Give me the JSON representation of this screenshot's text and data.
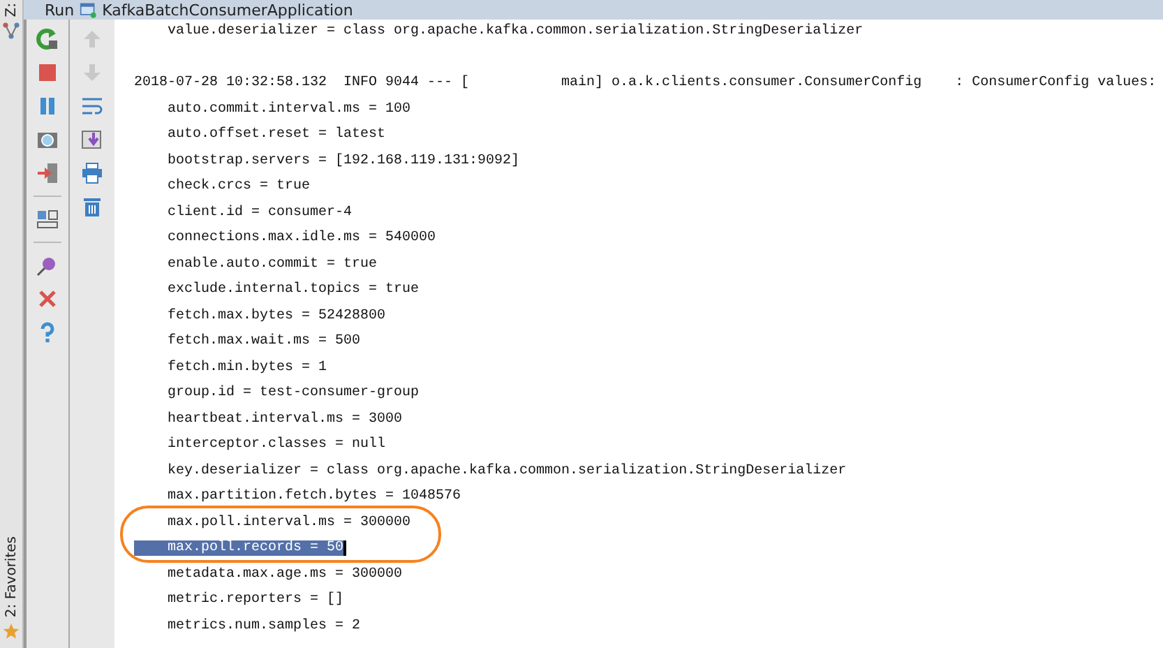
{
  "left_strip": {
    "top_tab": "Z:",
    "bottom_tab": "2: Favorites"
  },
  "run_bar": {
    "label": "Run",
    "config": "KafkaBatchConsumerApplication"
  },
  "console": {
    "lines": [
      {
        "text": "    value.deserializer = class org.apache.kafka.common.serialization.StringDeserializer",
        "selected": false
      },
      {
        "selected": false
      },
      {
        "text": "2018-07-28 10:32:58.132  INFO 9044 --- [           main] o.a.k.clients.consumer.ConsumerConfig    : ConsumerConfig values:",
        "selected": false
      },
      {
        "text": "    auto.commit.interval.ms = 100",
        "selected": false
      },
      {
        "text": "    auto.offset.reset = latest",
        "selected": false
      },
      {
        "text": "    bootstrap.servers = [192.168.119.131:9092]",
        "selected": false
      },
      {
        "text": "    check.crcs = true",
        "selected": false
      },
      {
        "text": "    client.id = consumer-4",
        "selected": false
      },
      {
        "text": "    connections.max.idle.ms = 540000",
        "selected": false
      },
      {
        "text": "    enable.auto.commit = true",
        "selected": false
      },
      {
        "text": "    exclude.internal.topics = true",
        "selected": false
      },
      {
        "text": "    fetch.max.bytes = 52428800",
        "selected": false
      },
      {
        "text": "    fetch.max.wait.ms = 500",
        "selected": false
      },
      {
        "text": "    fetch.min.bytes = 1",
        "selected": false
      },
      {
        "text": "    group.id = test-consumer-group",
        "selected": false
      },
      {
        "text": "    heartbeat.interval.ms = 3000",
        "selected": false
      },
      {
        "text": "    interceptor.classes = null",
        "selected": false
      },
      {
        "text": "    key.deserializer = class org.apache.kafka.common.serialization.StringDeserializer",
        "selected": false
      },
      {
        "text": "    max.partition.fetch.bytes = 1048576",
        "selected": false
      },
      {
        "text": "    max.poll.interval.ms = 300000",
        "selected": false
      },
      {
        "text": "    max.poll.records = 50",
        "selected": true
      },
      {
        "text": "    metadata.max.age.ms = 300000",
        "selected": false
      },
      {
        "text": "    metric.reporters = []",
        "selected": false
      },
      {
        "text": "    metrics.num.samples = 2",
        "selected": false
      }
    ]
  }
}
